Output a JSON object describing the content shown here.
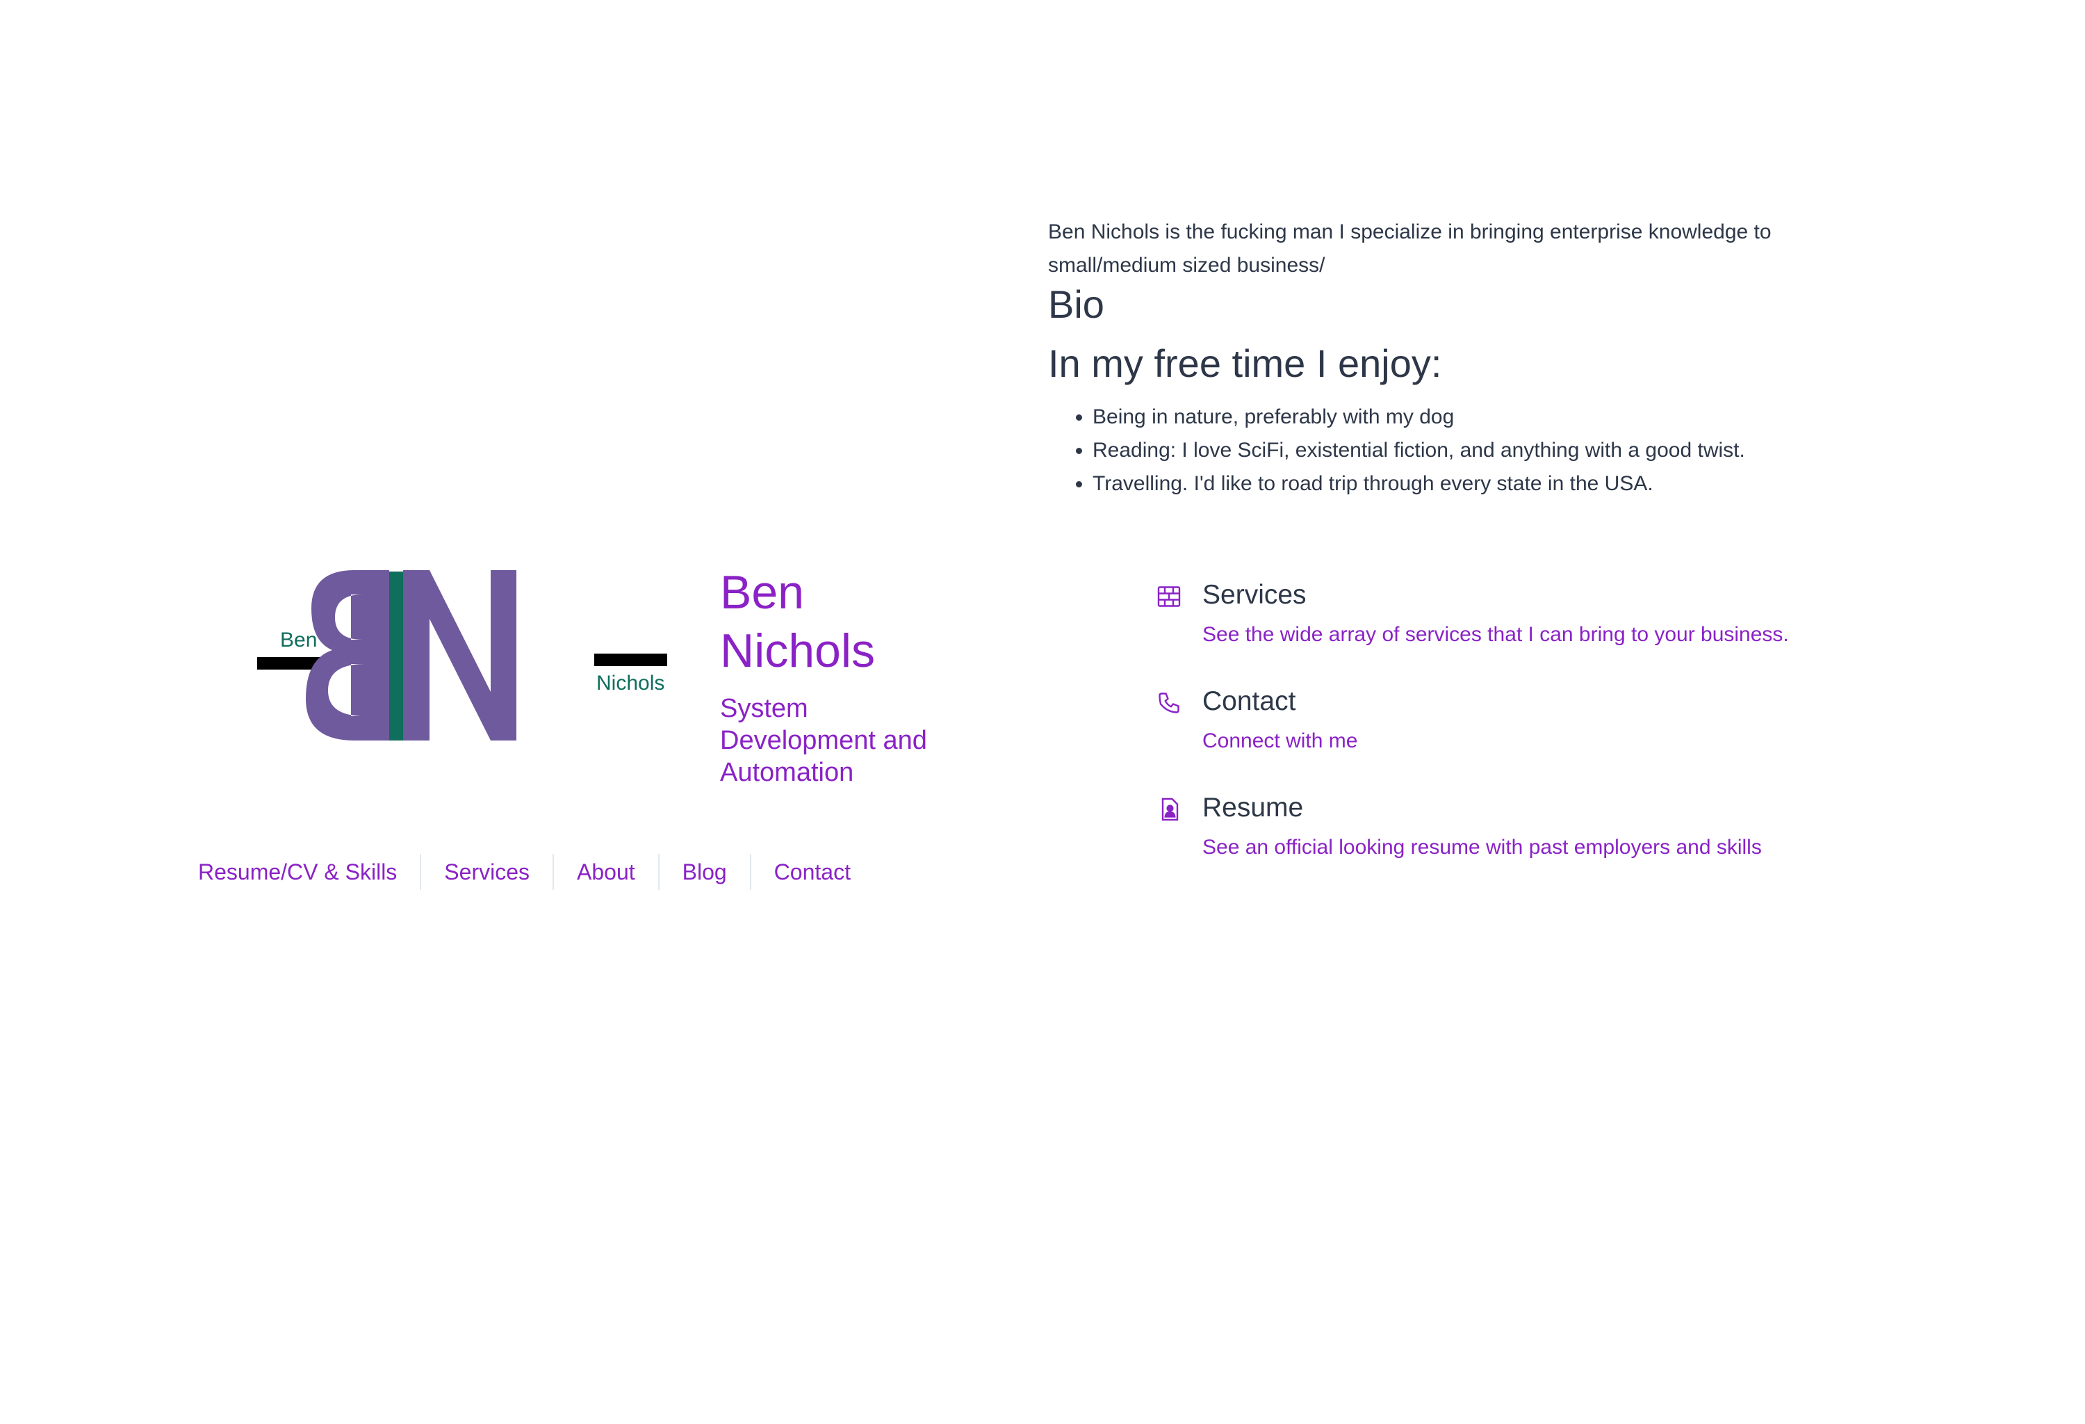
{
  "bio": {
    "intro": "Ben Nichols is the fucking man I specialize in bringing enterprise knowledge to small/medium sized business/",
    "heading": "Bio",
    "free_time_heading": "In my free time I enjoy:",
    "items": [
      "Being in nature, preferably with my dog",
      "Reading: I love SciFi, existential fiction, and anything with a good twist.",
      "Travelling. I'd like to road trip through every state in the USA."
    ]
  },
  "logo": {
    "letters": "BN",
    "left_label": "Ben",
    "right_label": "Nichols",
    "colors": {
      "letters": "#6f5a9e",
      "divider": "#0f6e5c",
      "bars": "#000000",
      "labels": "#0f6e5c"
    }
  },
  "header": {
    "name_line1": "Ben",
    "name_line2": "Nichols",
    "tagline": "System Development and Automation"
  },
  "nav": {
    "items": [
      "Resume/CV & Skills",
      "Services",
      "About",
      "Blog",
      "Contact"
    ]
  },
  "features": [
    {
      "icon": "brick-wall-icon",
      "title": "Services",
      "link": "See the wide array of services that I can bring to your business."
    },
    {
      "icon": "phone-icon",
      "title": "Contact",
      "link": "Connect with me"
    },
    {
      "icon": "resume-document-icon",
      "title": "Resume",
      "link": "See an official looking resume with past employers and skills"
    }
  ],
  "colors": {
    "accent": "#8a22c6",
    "text": "#2d3748",
    "divider": "#e2e8f0",
    "background": "#ffffff"
  }
}
